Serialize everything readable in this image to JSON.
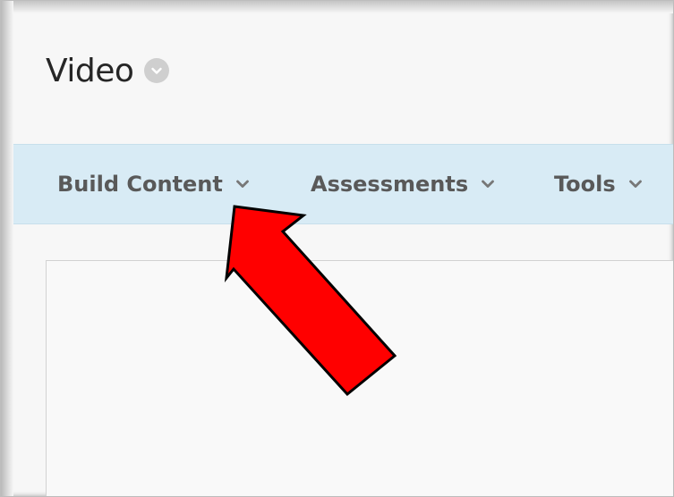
{
  "page": {
    "title": "Video"
  },
  "action_bar": {
    "items": [
      {
        "label": "Build Content"
      },
      {
        "label": "Assessments"
      },
      {
        "label": "Tools"
      }
    ]
  },
  "colors": {
    "action_bar_bg": "#d8ebf5",
    "action_text": "#595959",
    "annotation_arrow": "#ff0000",
    "title_menu_icon_bg": "#cfcfcf"
  },
  "icons": {
    "title_menu": "chevron-down-circle-icon",
    "dropdown": "chevron-down-icon",
    "annotation": "red-arrow-icon"
  }
}
